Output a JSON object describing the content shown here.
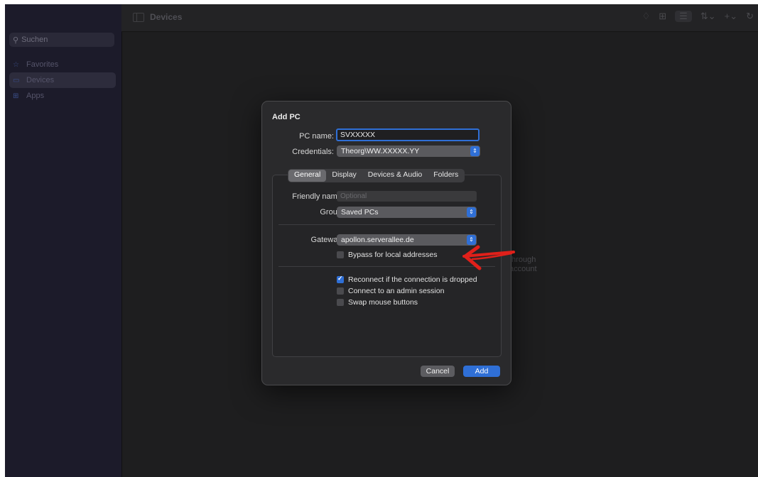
{
  "sidebar": {
    "search_placeholder": "Suchen",
    "items": [
      {
        "label": "Favorites",
        "icon": "star-icon"
      },
      {
        "label": "Devices",
        "icon": "monitor-icon"
      },
      {
        "label": "Apps",
        "icon": "grid-icon"
      }
    ]
  },
  "header": {
    "title": "Devices"
  },
  "background_text": {
    "line1": "through",
    "line2": "account"
  },
  "dialog": {
    "title": "Add PC",
    "pc_name_label": "PC name:",
    "pc_name_value": "SVXXXXX",
    "credentials_label": "Credentials:",
    "credentials_value": "Theorg\\WW.XXXXX.YY",
    "tabs": [
      "General",
      "Display",
      "Devices & Audio",
      "Folders"
    ],
    "selected_tab": "General",
    "friendly_name_label": "Friendly name:",
    "friendly_name_placeholder": "Optional",
    "group_label": "Group:",
    "group_value": "Saved PCs",
    "gateway_label": "Gateway:",
    "gateway_value": "apollon.serverallee.de",
    "bypass_label": "Bypass for local addresses",
    "bypass_checked": false,
    "reconnect_label": "Reconnect if the connection is dropped",
    "reconnect_checked": true,
    "admin_label": "Connect to an admin session",
    "admin_checked": false,
    "swap_label": "Swap mouse buttons",
    "swap_checked": false,
    "cancel_label": "Cancel",
    "add_label": "Add"
  },
  "colors": {
    "accent": "#2f6fd6",
    "annotation": "#e0201a"
  }
}
